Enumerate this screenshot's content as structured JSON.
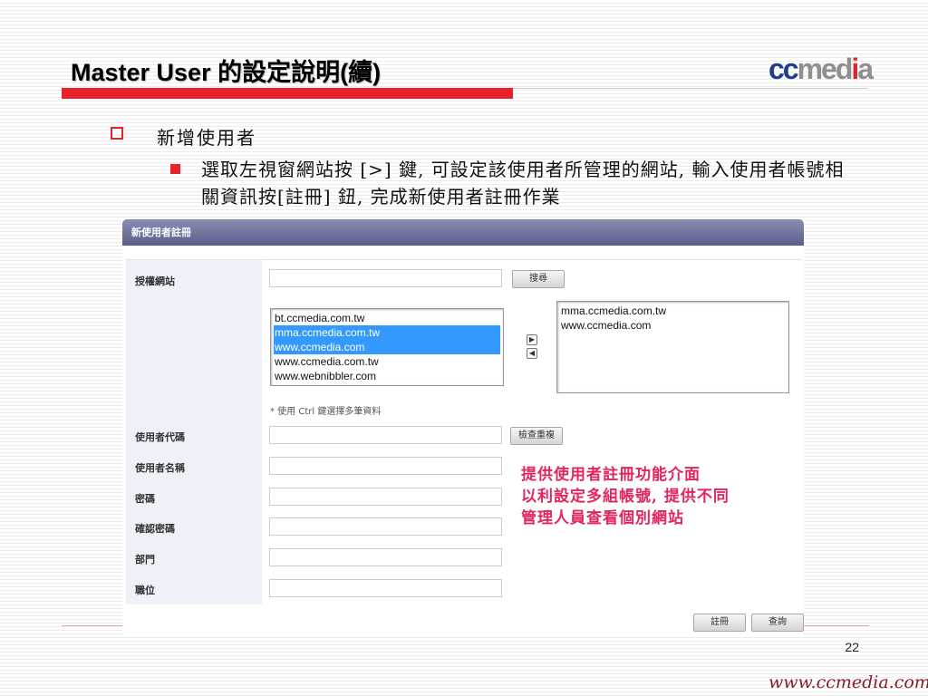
{
  "slide": {
    "title": "Master User 的設定說明(續)",
    "logo": {
      "cc": "cc",
      "media": "med",
      "i": "i",
      "a": "a"
    },
    "heading": "新增使用者",
    "paragraph": "選取左視窗網站按 [>] 鍵, 可設定該使用者所管理的網站, 輸入使用者帳號相關資訊按[註冊] 鈕, 完成新使用者註冊作業",
    "annotation_lines": [
      "提供使用者註冊功能介面",
      "以利設定多組帳號, 提供不同",
      "管理人員查看個別網站"
    ],
    "page_number": "22",
    "website": "www.ccmedia.com"
  },
  "form": {
    "header": "新使用者註冊",
    "labels": {
      "sites": "授權網站",
      "user_id": "使用者代碼",
      "user_name": "使用者名稱",
      "password": "密碼",
      "confirm_password": "確認密碼",
      "department": "部門",
      "position": "職位"
    },
    "search_button": "搜尋",
    "check_button": "檢查重複",
    "available_sites": [
      {
        "label": "bt.ccmedia.com.tw",
        "selected": false
      },
      {
        "label": "mma.ccmedia.com.tw",
        "selected": true
      },
      {
        "label": "www.ccmedia.com",
        "selected": true
      },
      {
        "label": "www.ccmedia.com.tw",
        "selected": false
      },
      {
        "label": "www.webnibbler.com",
        "selected": false
      }
    ],
    "assigned_sites": [
      "mma.ccmedia.com.tw",
      "www.ccmedia.com"
    ],
    "add_arrow": "▶",
    "remove_arrow": "◀",
    "hint": "* 使用 Ctrl 鍵選擇多筆資料",
    "register_button": "註冊",
    "query_button": "查詢",
    "inputs": {
      "sites_search": "",
      "user_id": "",
      "user_name": "",
      "password": "",
      "confirm_password": "",
      "department": "",
      "position": ""
    }
  },
  "colors": {
    "accent_red": "#e8212a",
    "logo_blue": "#1d3f8e",
    "annotation_pink": "#e4255d",
    "selection_blue": "#3399ff"
  }
}
